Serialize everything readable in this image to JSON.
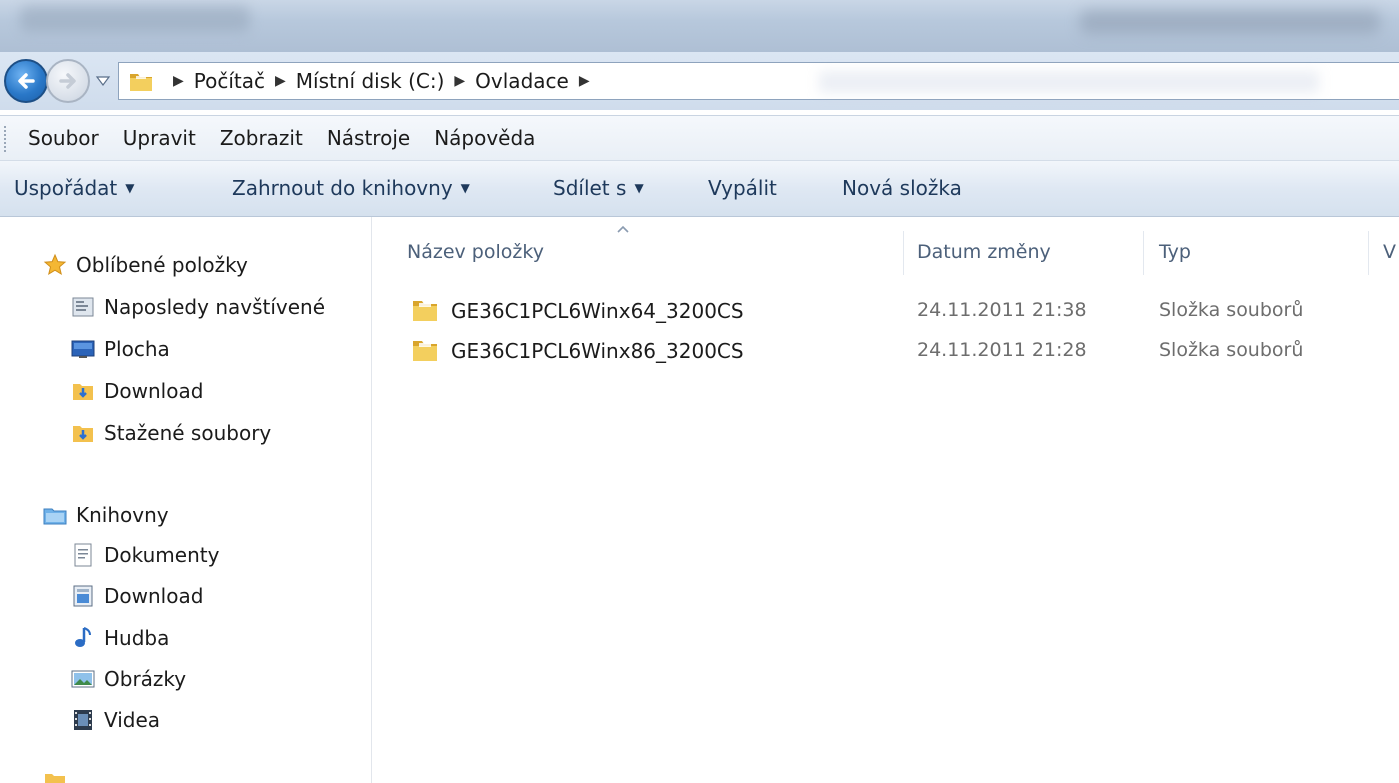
{
  "address": {
    "crumbs": [
      "Počítač",
      "Místní disk (C:)",
      "Ovladace"
    ]
  },
  "menu": {
    "items": [
      "Soubor",
      "Upravit",
      "Zobrazit",
      "Nástroje",
      "Nápověda"
    ]
  },
  "commands": {
    "organize": "Uspořádat",
    "include_library": "Zahrnout do knihovny",
    "share": "Sdílet s",
    "burn": "Vypálit",
    "new_folder": "Nová složka"
  },
  "nav": {
    "favorites": {
      "label": "Oblíbené položky",
      "items": [
        "Naposledy navštívené",
        "Plocha",
        "Download",
        "Stažené soubory"
      ]
    },
    "libraries": {
      "label": "Knihovny",
      "items": [
        "Dokumenty",
        "Download",
        "Hudba",
        "Obrázky",
        "Videa"
      ]
    }
  },
  "columns": {
    "name": "Název položky",
    "date": "Datum změny",
    "type": "Typ",
    "size": "V"
  },
  "files": [
    {
      "name": "GE36C1PCL6Winx64_3200CS",
      "date": "24.11.2011 21:38",
      "type": "Složka souborů"
    },
    {
      "name": "GE36C1PCL6Winx86_3200CS",
      "date": "24.11.2011 21:28",
      "type": "Složka souborů"
    }
  ],
  "colors": {
    "command_text": "#1e395b",
    "header_text": "#4c607a",
    "folder_yellow": "#e8b93c"
  }
}
